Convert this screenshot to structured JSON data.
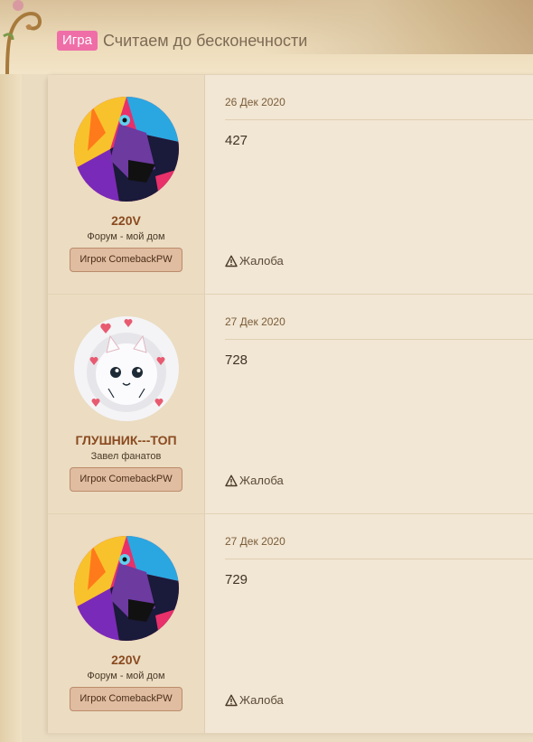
{
  "thread": {
    "prefix": "Игра",
    "title": "Считаем до бесконечности"
  },
  "posts": [
    {
      "username": "220V",
      "user_title": "Форум - мой дом",
      "banner": "Игрок ComebackPW",
      "avatar": "lion-avatar",
      "date": "26 Дек 2020",
      "message": "427",
      "report_label": "Жалоба"
    },
    {
      "username": "ГЛУШНИК---ТОП",
      "user_title": "Завел фанатов",
      "banner": "Игрок ComebackPW",
      "avatar": "white-cat-avatar",
      "date": "27 Дек 2020",
      "message": "728",
      "report_label": "Жалоба"
    },
    {
      "username": "220V",
      "user_title": "Форум - мой дом",
      "banner": "Игрок ComebackPW",
      "avatar": "lion-avatar",
      "date": "27 Дек 2020",
      "message": "729",
      "report_label": "Жалоба"
    }
  ],
  "colors": {
    "prefix_bg": "#f06ea8",
    "username": "#8a4a1f",
    "banner_bg": "#e0bca0"
  }
}
